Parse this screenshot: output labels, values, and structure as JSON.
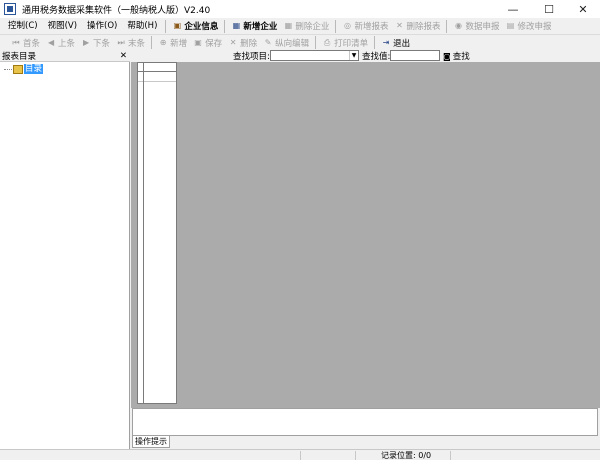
{
  "window": {
    "title": "通用税务数据采集软件（一般纳税人版）V2.40",
    "minimize": "—",
    "maximize": "☐",
    "close": "✕"
  },
  "menu": [
    {
      "label": "控制(C)"
    },
    {
      "label": "视图(V)"
    },
    {
      "label": "操作(O)"
    },
    {
      "label": "帮助(H)"
    }
  ],
  "toolbar1": [
    {
      "label": "企业信息",
      "icon": "briefcase-icon",
      "glyph": "▣",
      "disabled": false,
      "bold": true
    },
    {
      "label": "新增企业",
      "icon": "new-company-icon",
      "glyph": "▦",
      "disabled": false,
      "bold": true
    },
    {
      "label": "删除企业",
      "icon": "delete-company-icon",
      "glyph": "▦",
      "disabled": true,
      "bold": false
    },
    {
      "label": "新增报表",
      "icon": "new-report-icon",
      "glyph": "◎",
      "disabled": true,
      "bold": false
    },
    {
      "label": "删除报表",
      "icon": "delete-report-icon",
      "glyph": "✕",
      "disabled": true,
      "bold": false
    },
    {
      "label": "数据申报",
      "icon": "declare-icon",
      "glyph": "◉",
      "disabled": true,
      "bold": false
    },
    {
      "label": "修改申报",
      "icon": "edit-declare-icon",
      "glyph": "▤",
      "disabled": true,
      "bold": false
    }
  ],
  "toolbar2": [
    {
      "label": "首条",
      "icon": "first-record-icon",
      "glyph": "⏮"
    },
    {
      "label": "上条",
      "icon": "prev-record-icon",
      "glyph": "◀"
    },
    {
      "label": "下条",
      "icon": "next-record-icon",
      "glyph": "▶"
    },
    {
      "label": "末条",
      "icon": "last-record-icon",
      "glyph": "⏭"
    },
    {
      "label": "新增",
      "icon": "add-icon",
      "glyph": "⊕"
    },
    {
      "label": "保存",
      "icon": "save-icon",
      "glyph": "▣"
    },
    {
      "label": "删除",
      "icon": "delete-icon",
      "glyph": "✕"
    },
    {
      "label": "纵向编辑",
      "icon": "vertical-edit-icon",
      "glyph": "✎"
    },
    {
      "label": "打印清单",
      "icon": "print-icon",
      "glyph": "⎙"
    }
  ],
  "exit_button": {
    "label": "退出",
    "icon": "exit-icon",
    "glyph": "⇥"
  },
  "tree_panel": {
    "title": "报表目录",
    "close": "✕",
    "root_label": "目录"
  },
  "search": {
    "field_label": "查找项目:",
    "value_label": "查找值:",
    "button_label": "查找",
    "field_value": "",
    "input_value": ""
  },
  "hint_tab": {
    "label": "操作提示"
  },
  "status": {
    "record_position": "记录位置: 0/0"
  }
}
